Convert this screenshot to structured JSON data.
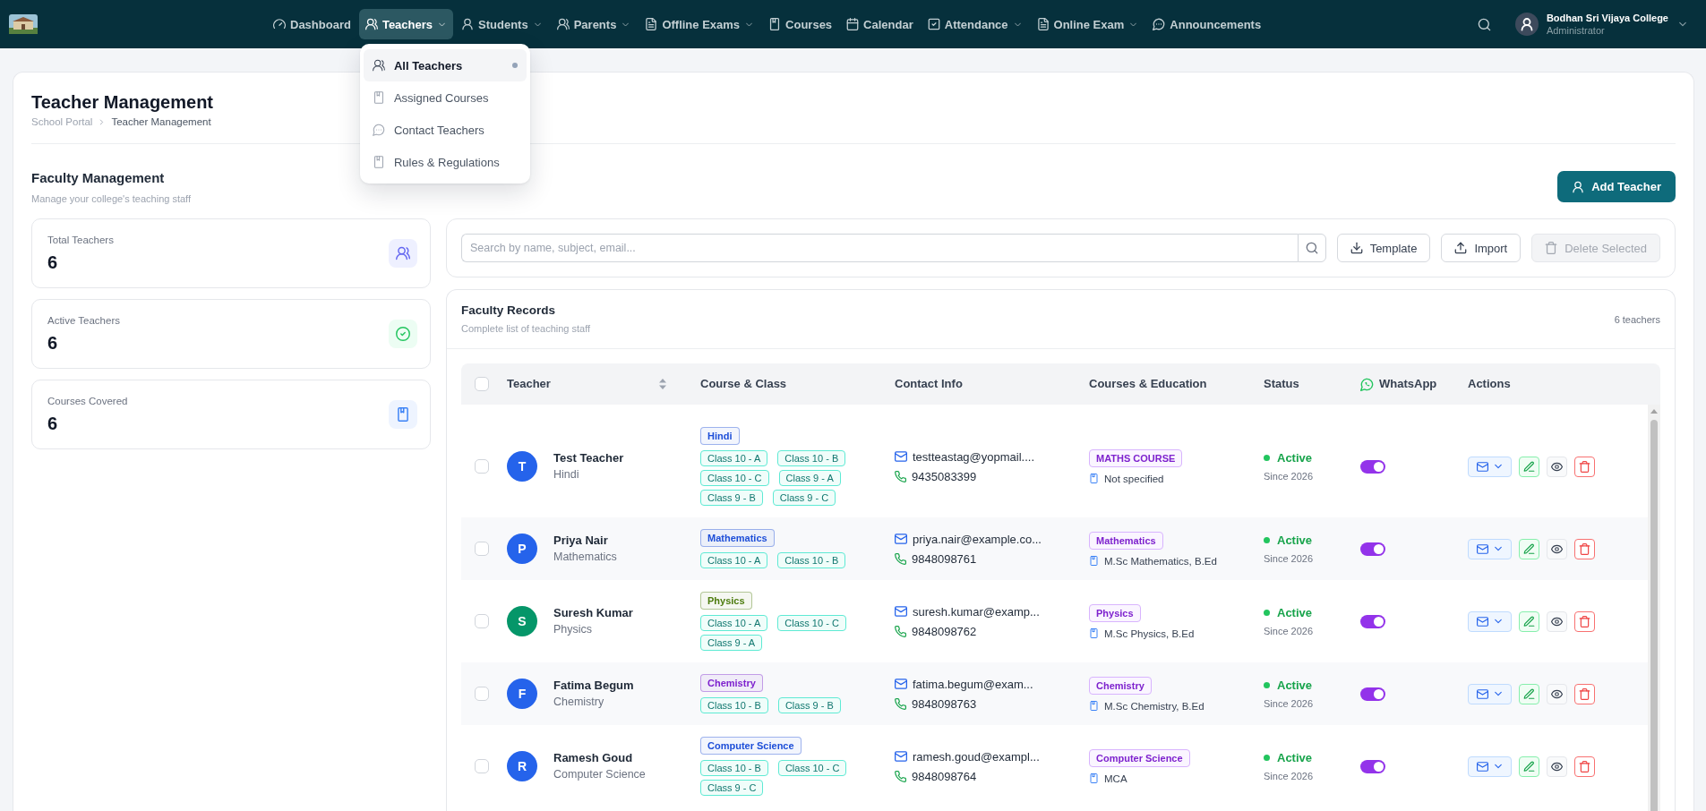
{
  "nav": {
    "items": [
      {
        "label": "Dashboard",
        "has_dropdown": false,
        "selected": false
      },
      {
        "label": "Teachers",
        "has_dropdown": true,
        "selected": true
      },
      {
        "label": "Students",
        "has_dropdown": true,
        "selected": false
      },
      {
        "label": "Parents",
        "has_dropdown": true,
        "selected": false
      },
      {
        "label": "Offline Exams",
        "has_dropdown": true,
        "selected": false
      },
      {
        "label": "Courses",
        "has_dropdown": false,
        "selected": false
      },
      {
        "label": "Calendar",
        "has_dropdown": false,
        "selected": false
      },
      {
        "label": "Attendance",
        "has_dropdown": true,
        "selected": false
      },
      {
        "label": "Online Exam",
        "has_dropdown": true,
        "selected": false
      },
      {
        "label": "Announcements",
        "has_dropdown": false,
        "selected": false
      }
    ],
    "dropdown": {
      "items": [
        {
          "label": "All Teachers",
          "selected": true
        },
        {
          "label": "Assigned Courses",
          "selected": false
        },
        {
          "label": "Contact Teachers",
          "selected": false
        },
        {
          "label": "Rules & Regulations",
          "selected": false
        }
      ]
    },
    "user": {
      "name": "Bodhan Sri Vijaya College",
      "role": "Administrator"
    }
  },
  "header": {
    "title": "Teacher Management",
    "breadcrumb": [
      "School Portal",
      "Teacher Management"
    ]
  },
  "section": {
    "title": "Faculty Management",
    "subtitle": "Manage your college's teaching staff",
    "add_button": "Add Teacher"
  },
  "stats": [
    {
      "label": "Total Teachers",
      "value": "6"
    },
    {
      "label": "Active Teachers",
      "value": "6"
    },
    {
      "label": "Courses Covered",
      "value": "6"
    }
  ],
  "toolbar": {
    "search": {
      "placeholder": "Search by name, subject, email..."
    },
    "buttons": [
      {
        "label": "Template",
        "disabled": false
      },
      {
        "label": "Import",
        "disabled": false
      },
      {
        "label": "Delete Selected",
        "disabled": true
      }
    ]
  },
  "records": {
    "title": "Faculty Records",
    "subtitle": "Complete list of teaching staff",
    "count": "6 teachers",
    "table": {
      "select_all_checked": false,
      "columns": [
        {
          "label": "Teacher",
          "sortable": true
        },
        {
          "label": "Course & Class",
          "sortable": false
        },
        {
          "label": "Contact Info",
          "sortable": false
        },
        {
          "label": "Courses & Education",
          "sortable": false
        },
        {
          "label": "Status",
          "sortable": false
        },
        {
          "label": "WhatsApp",
          "sortable": false
        },
        {
          "label": "Actions",
          "sortable": false
        }
      ],
      "rows": [
        {
          "checked": false,
          "avatar": {
            "initial": "T",
            "color": "#2563eb"
          },
          "name": "Test Teacher",
          "subject": "Hindi",
          "subject_tag": {
            "label": "Hindi",
            "color": "#1d4ed8"
          },
          "classes": [
            "Class 10 - A",
            "Class 10 - B",
            "Class 10 - C",
            "Class 9 - A",
            "Class 9 - B",
            "Class 9 - C"
          ],
          "email": "testteastag@yopmail....",
          "phone": "9435083399",
          "course": "MATHS COURSE",
          "education": "Not specified",
          "status": "Active",
          "active": true,
          "since": "Since 2026",
          "whatsapp": true
        },
        {
          "checked": false,
          "avatar": {
            "initial": "P",
            "color": "#2563eb"
          },
          "name": "Priya Nair",
          "subject": "Mathematics",
          "subject_tag": {
            "label": "Mathematics",
            "color": "#1d4ed8"
          },
          "classes": [
            "Class 10 - A",
            "Class 10 - B"
          ],
          "email": "priya.nair@example.co...",
          "phone": "9848098761",
          "course": "Mathematics",
          "education": "M.Sc Mathematics, B.Ed",
          "status": "Active",
          "active": true,
          "since": "Since 2026",
          "whatsapp": true
        },
        {
          "checked": false,
          "avatar": {
            "initial": "S",
            "color": "#059669"
          },
          "name": "Suresh Kumar",
          "subject": "Physics",
          "subject_tag": {
            "label": "Physics",
            "color": "#4d7c0f"
          },
          "classes": [
            "Class 10 - A",
            "Class 10 - C",
            "Class 9 - A"
          ],
          "email": "suresh.kumar@examp...",
          "phone": "9848098762",
          "course": "Physics",
          "education": "M.Sc Physics, B.Ed",
          "status": "Active",
          "active": true,
          "since": "Since 2026",
          "whatsapp": true
        },
        {
          "checked": false,
          "avatar": {
            "initial": "F",
            "color": "#2563eb"
          },
          "name": "Fatima Begum",
          "subject": "Chemistry",
          "subject_tag": {
            "label": "Chemistry",
            "color": "#7e22ce"
          },
          "classes": [
            "Class 10 - B",
            "Class 9 - B"
          ],
          "email": "fatima.begum@exam...",
          "phone": "9848098763",
          "course": "Chemistry",
          "education": "M.Sc Chemistry, B.Ed",
          "status": "Active",
          "active": true,
          "since": "Since 2026",
          "whatsapp": true
        },
        {
          "checked": false,
          "avatar": {
            "initial": "R",
            "color": "#2563eb"
          },
          "name": "Ramesh Goud",
          "subject": "Computer Science",
          "subject_tag": {
            "label": "Computer Science",
            "color": "#1d4ed8"
          },
          "classes": [
            "Class 10 - B",
            "Class 10 - C",
            "Class 9 - C"
          ],
          "email": "ramesh.goud@exampl...",
          "phone": "9848098764",
          "course": "Computer Science",
          "education": "MCA",
          "status": "Active",
          "active": true,
          "since": "Since 2026",
          "whatsapp": true
        }
      ]
    }
  }
}
